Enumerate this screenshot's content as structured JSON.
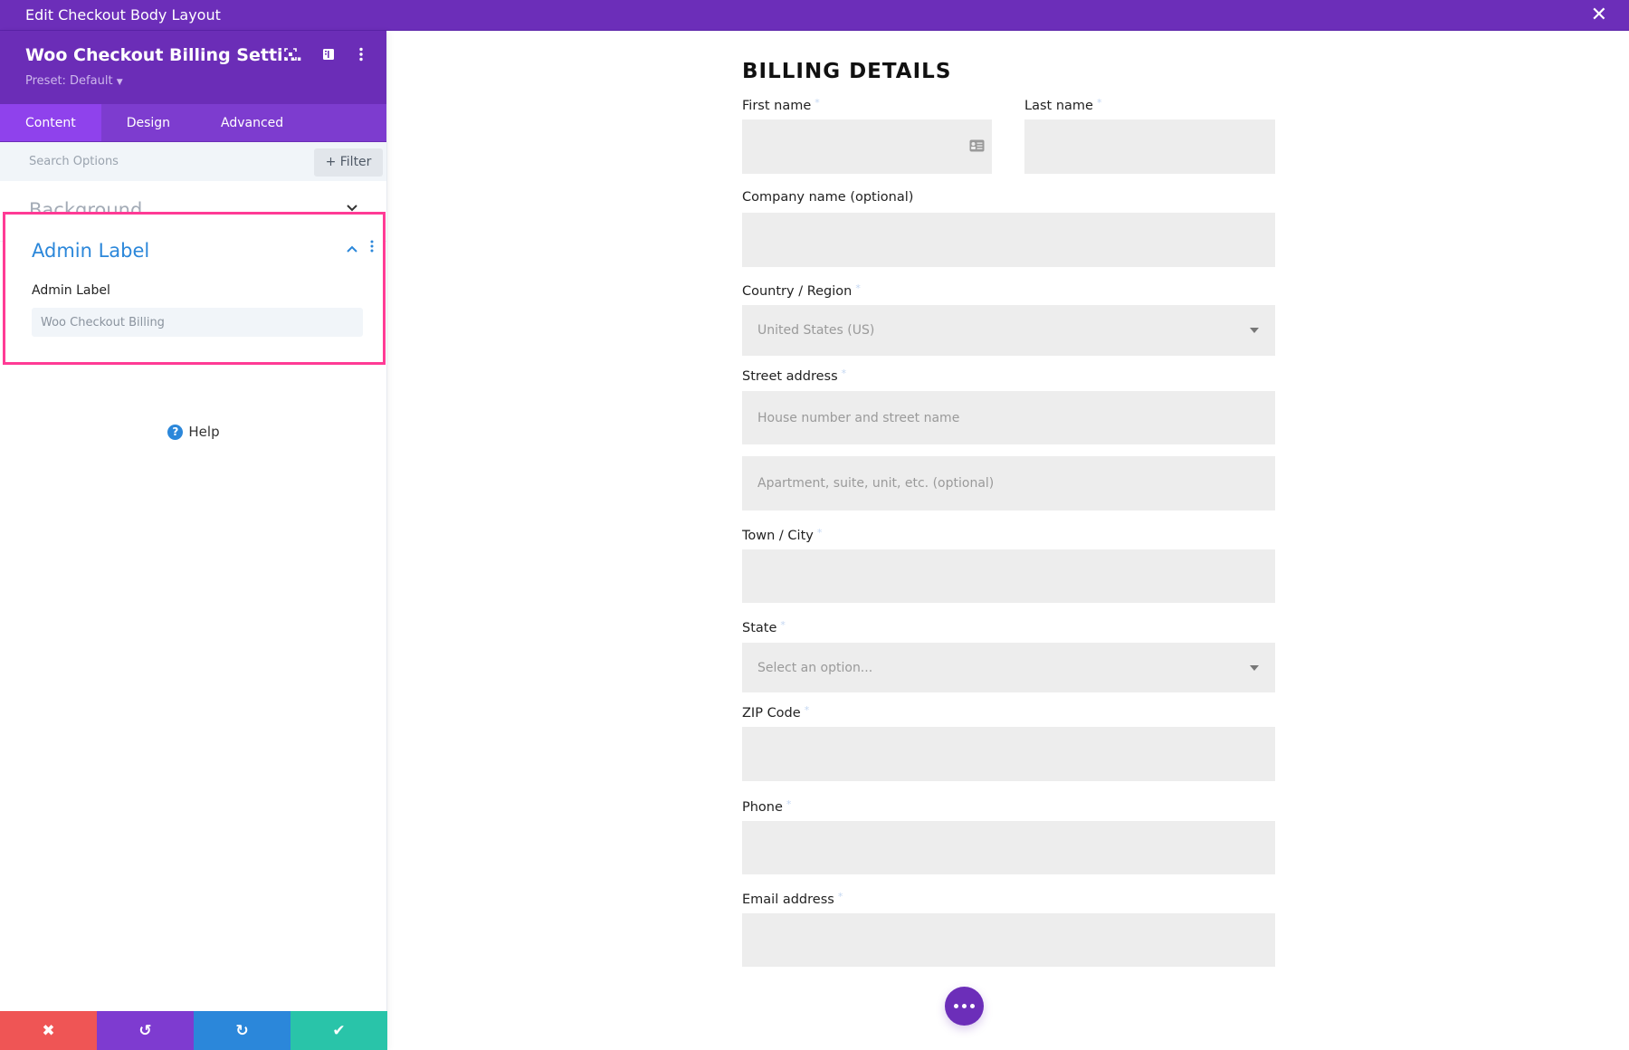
{
  "window": {
    "title": "Edit Checkout Body Layout",
    "close_icon": "close-icon"
  },
  "panel": {
    "module_title": "Woo Checkout Billing Setti...",
    "preset": "Preset: Default",
    "header_icons": [
      "focus-icon",
      "split-view-icon",
      "more-vertical-icon"
    ],
    "tabs": [
      {
        "label": "Content",
        "active": true
      },
      {
        "label": "Design",
        "active": false
      },
      {
        "label": "Advanced",
        "active": false
      }
    ],
    "search_placeholder": "Search Options",
    "filter_label": "Filter",
    "sections": {
      "background": {
        "title": "Background",
        "expanded": false
      },
      "admin_label": {
        "title": "Admin Label",
        "expanded": true,
        "field_label": "Admin Label",
        "field_value": "Woo Checkout Billing"
      }
    },
    "help_label": "Help",
    "footer_buttons": [
      {
        "name": "discard",
        "icon": "✖",
        "color": "#ef5555"
      },
      {
        "name": "undo",
        "icon": "↺",
        "color": "#7e3bd0"
      },
      {
        "name": "redo",
        "icon": "↻",
        "color": "#2b87da"
      },
      {
        "name": "save",
        "icon": "✔",
        "color": "#29c4a9"
      }
    ]
  },
  "form": {
    "title": "BILLING DETAILS",
    "required_mark": "*",
    "fields": {
      "first_name": {
        "label": "First name",
        "required": true,
        "value": ""
      },
      "last_name": {
        "label": "Last name",
        "required": true,
        "value": ""
      },
      "company": {
        "label": "Company name (optional)",
        "required": false,
        "value": ""
      },
      "country": {
        "label": "Country / Region",
        "required": true,
        "value": "United States (US)"
      },
      "street": {
        "label": "Street address",
        "required": true,
        "placeholder": "House number and street name",
        "placeholder2": "Apartment, suite, unit, etc. (optional)"
      },
      "city": {
        "label": "Town / City",
        "required": true,
        "value": ""
      },
      "state": {
        "label": "State",
        "required": true,
        "value": "Select an option..."
      },
      "zip": {
        "label": "ZIP Code",
        "required": true,
        "value": ""
      },
      "phone": {
        "label": "Phone",
        "required": true,
        "value": ""
      },
      "email": {
        "label": "Email address",
        "required": true,
        "value": ""
      }
    }
  },
  "colors": {
    "brand_purple": "#6c2eb9",
    "accent_blue": "#2b87da",
    "highlight_pink": "#ff3b95"
  }
}
